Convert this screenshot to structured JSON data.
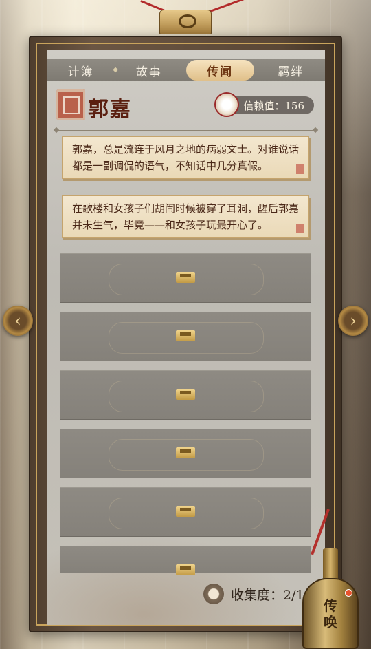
{
  "tabs": [
    {
      "label": "计簿",
      "active": false
    },
    {
      "label": "故事",
      "active": false
    },
    {
      "label": "传闻",
      "active": true
    },
    {
      "label": "羁绊",
      "active": false
    }
  ],
  "character": {
    "name": "郭嘉",
    "trust_label": "信赖值：156"
  },
  "rumors": [
    {
      "text": "郭嘉，总是流连于风月之地的病弱文士。对谁说话都是一副调侃的语气，不知话中几分真假。"
    },
    {
      "text": "在歌楼和女孩子们胡闹时候被穿了耳洞，醒后郭嘉并未生气，毕竟——和女孩子玩最开心了。"
    }
  ],
  "locked_slots": 6,
  "collection": {
    "label": "收集度：2/15",
    "collected": 2,
    "total": 15
  },
  "bell": {
    "label_top": "传",
    "label_bottom": "唤"
  },
  "colors": {
    "tab_active": "#e0c08a",
    "name_text": "#5a1f10",
    "note_bg": "#f3e7cf",
    "locked_slot": "#8e8a83",
    "frame_gold": "#c9a45c"
  },
  "icons": {
    "prev": "arrow-left-icon",
    "next": "arrow-right-icon",
    "lock": "lock-icon",
    "trust": "flower-icon",
    "bag": "pouch-icon",
    "bell": "bell-icon"
  }
}
